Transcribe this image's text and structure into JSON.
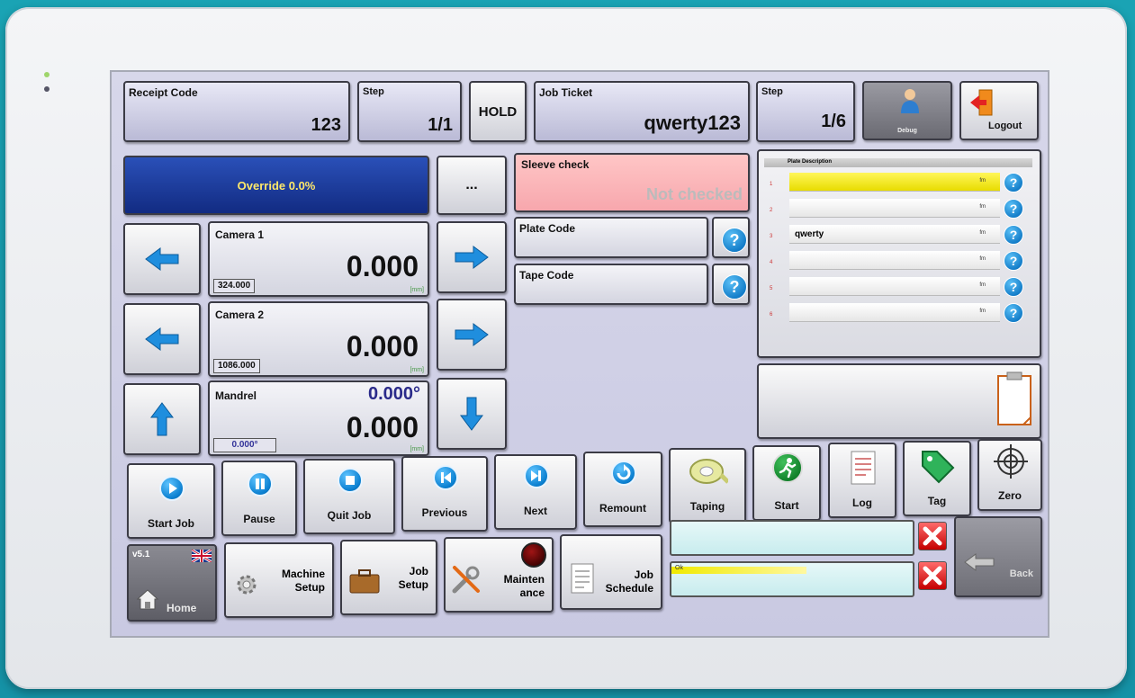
{
  "header": {
    "receipt": {
      "label": "Receipt Code",
      "value": "123"
    },
    "step1": {
      "label": "Step",
      "value": "1/1"
    },
    "hold": "HOLD",
    "job_ticket": {
      "label": "Job Ticket",
      "value": "qwerty123"
    },
    "step2": {
      "label": "Step",
      "value": "1/6"
    },
    "debug": "Debug",
    "logout": "Logout"
  },
  "override": {
    "label": "Override 0.0%",
    "color": "#1d3c9a"
  },
  "more_button": "...",
  "sleeve": {
    "label": "Sleeve check",
    "status": "Not checked"
  },
  "plate_code": {
    "label": "Plate Code"
  },
  "tape_code": {
    "label": "Tape Code"
  },
  "camera1": {
    "label": "Camera 1",
    "value": "0.000",
    "sub": "324.000",
    "unit": "[mm]"
  },
  "camera2": {
    "label": "Camera 2",
    "value": "0.000",
    "sub": "1086.000",
    "unit": "[mm]"
  },
  "mandrel": {
    "label": "Mandrel",
    "angle": "0.000°",
    "value": "0.000",
    "sub": "0.000°",
    "unit": "[mm]"
  },
  "plates": {
    "header": "Plate Description",
    "rows": [
      {
        "num": "1",
        "text": "",
        "unit": "fm",
        "selected": true
      },
      {
        "num": "2",
        "text": "",
        "unit": "fm",
        "selected": false
      },
      {
        "num": "3",
        "text": "qwerty",
        "unit": "fm",
        "selected": false
      },
      {
        "num": "4",
        "text": "",
        "unit": "fm",
        "selected": false
      },
      {
        "num": "5",
        "text": "",
        "unit": "fm",
        "selected": false
      },
      {
        "num": "6",
        "text": "",
        "unit": "fm",
        "selected": false
      }
    ]
  },
  "actions": {
    "start_job": "Start Job",
    "pause": "Pause",
    "quit_job": "Quit Job",
    "previous": "Previous",
    "next": "Next",
    "remount": "Remount",
    "taping": "Taping",
    "start": "Start",
    "log": "Log",
    "tag": "Tag",
    "zero": "Zero"
  },
  "nav": {
    "version": "v5.1",
    "home": "Home",
    "machine_setup": "Machine Setup",
    "job_setup": "Job Setup",
    "maintenance": "Mainten ance",
    "job_schedule": "Job Schedule",
    "status_msg": "Ok",
    "back": "Back"
  }
}
